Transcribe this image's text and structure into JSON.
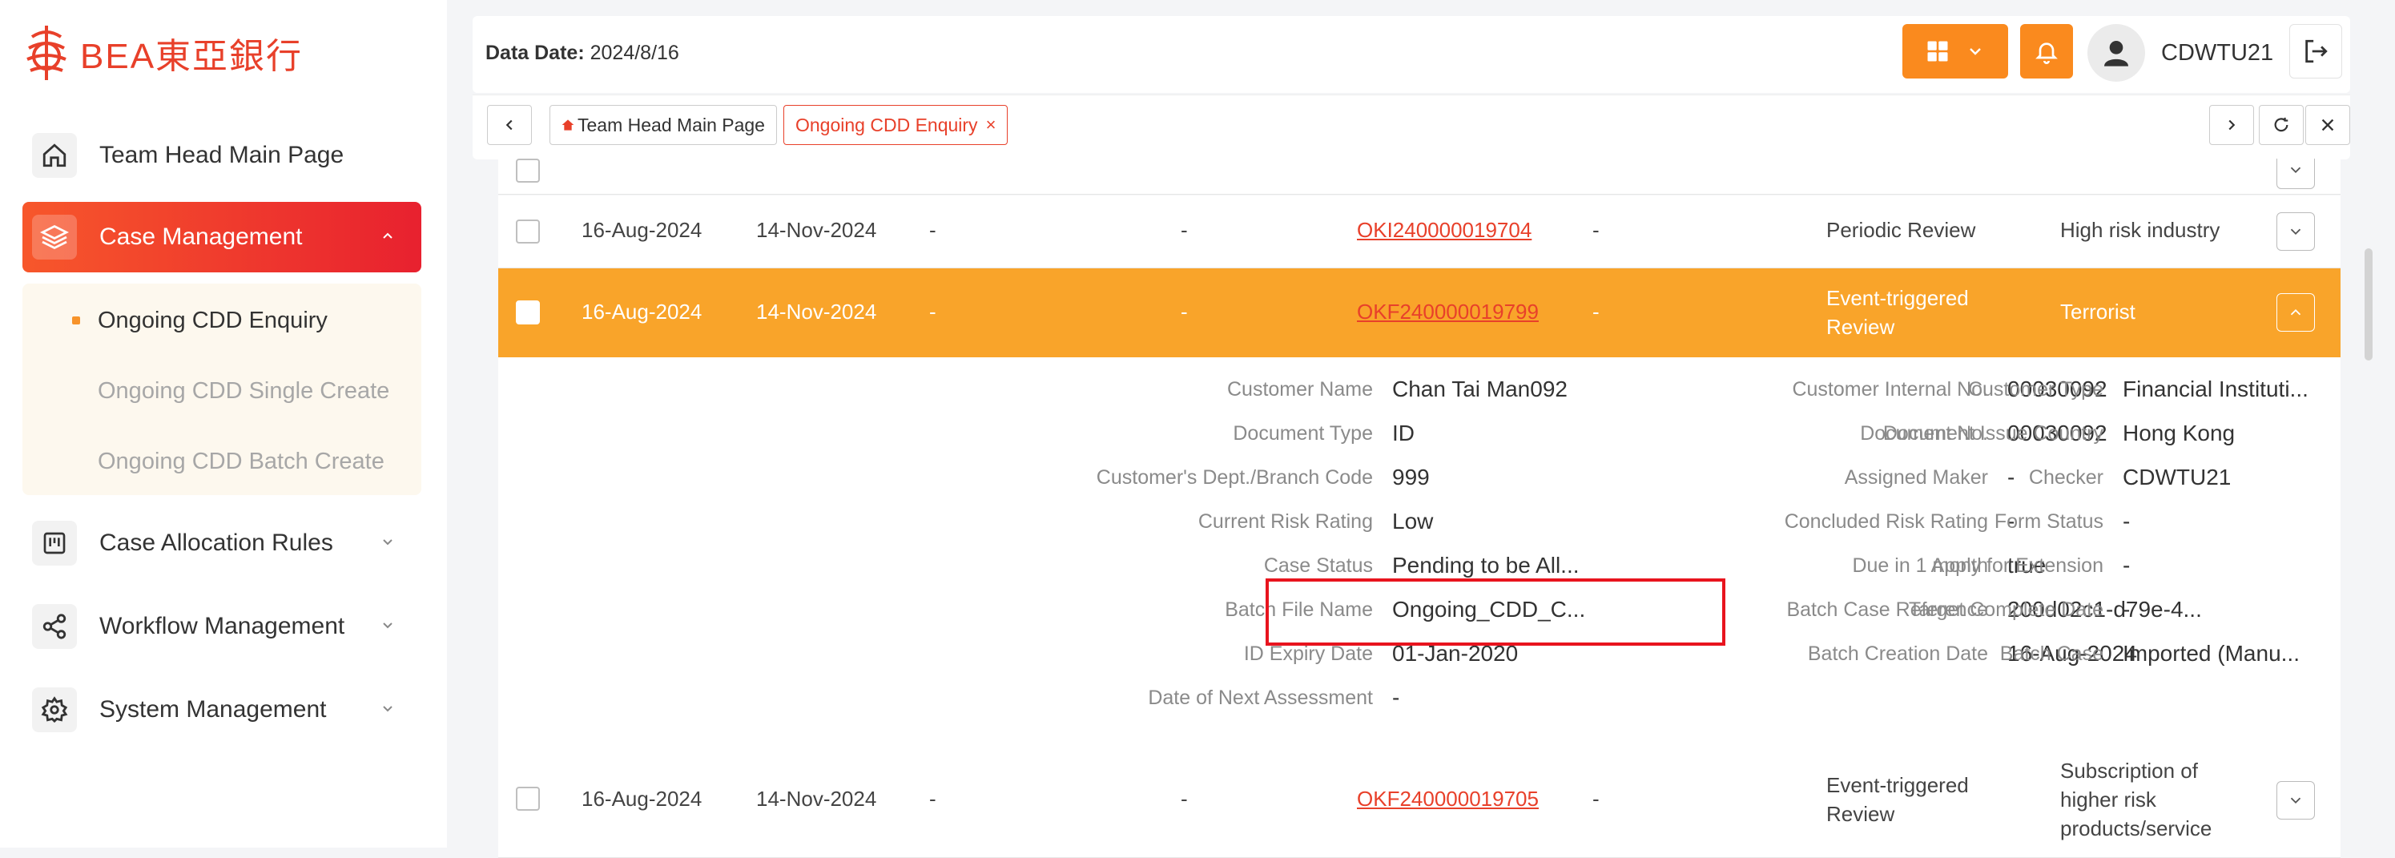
{
  "brand": {
    "name": "BEA東亞銀行",
    "color": "#e8402a"
  },
  "sidebar": {
    "items": [
      {
        "label": "Team Head Main Page",
        "icon": "home-icon"
      },
      {
        "label": "Case Management",
        "icon": "layers-icon"
      },
      {
        "label": "Case Allocation Rules",
        "icon": "rules-icon"
      },
      {
        "label": "Workflow Management",
        "icon": "share-icon"
      },
      {
        "label": "System Management",
        "icon": "gear-icon"
      }
    ],
    "submenu": [
      {
        "label": "Ongoing CDD Enquiry"
      },
      {
        "label": "Ongoing CDD Single Create"
      },
      {
        "label": "Ongoing CDD Batch Create"
      }
    ]
  },
  "header": {
    "data_date_label": "Data Date:",
    "data_date_value": "2024/8/16",
    "username": "CDWTU21",
    "accent": "#fa8a1e"
  },
  "tabs": [
    {
      "label": "Team Head Main Page"
    },
    {
      "label": "Ongoing CDD Enquiry",
      "close": "×"
    }
  ],
  "rows": [
    {
      "date1": "16-Aug-2024",
      "date2": "14-Nov-2024",
      "c3": "-",
      "c4": "-",
      "case_no": "OKI240000019704",
      "c6": "-",
      "type": "Periodic Review",
      "reason": "High risk industry"
    },
    {
      "date1": "16-Aug-2024",
      "date2": "14-Nov-2024",
      "c3": "-",
      "c4": "-",
      "case_no": "OKF240000019799",
      "c6": "-",
      "type": "Event-triggered Review",
      "reason": "Terrorist"
    },
    {
      "date1": "16-Aug-2024",
      "date2": "14-Nov-2024",
      "c3": "-",
      "c4": "-",
      "case_no": "OKF240000019705",
      "c6": "-",
      "type": "Event-triggered Review",
      "reason": "Subscription of higher risk products/service"
    }
  ],
  "details": [
    [
      {
        "label": "Customer Name",
        "value": "Chan Tai Man092"
      },
      {
        "label": "Document Type",
        "value": "ID"
      },
      {
        "label": "Customer's Dept./Branch Code",
        "value": "999"
      },
      {
        "label": "Current Risk Rating",
        "value": "Low"
      },
      {
        "label": "Case Status",
        "value": "Pending to be All..."
      },
      {
        "label": "Batch File Name",
        "value": "Ongoing_CDD_C..."
      },
      {
        "label": "ID Expiry Date",
        "value": "01-Jan-2020"
      },
      {
        "label": "Date of Next Assessment",
        "value": "-"
      }
    ],
    [
      {
        "label": "Customer Internal No.",
        "value": "00030092"
      },
      {
        "label": "Document No.",
        "value": "00030092"
      },
      {
        "label": "Assigned Maker",
        "value": "-"
      },
      {
        "label": "Concluded Risk Rating",
        "value": "-"
      },
      {
        "label": "Due in 1 month",
        "value": "true"
      },
      {
        "label": "Batch Case Reference",
        "value": "200d02c1-d79e-4..."
      },
      {
        "label": "Batch Creation Date",
        "value": "16-Aug-2024"
      }
    ],
    [
      {
        "label": "Customer Type",
        "value": "Financial Instituti..."
      },
      {
        "label": "Document Issue Country",
        "value": "Hong Kong"
      },
      {
        "label": "Checker",
        "value": "CDWTU21"
      },
      {
        "label": "Form Status",
        "value": "-"
      },
      {
        "label": "Apply for Extension",
        "value": "-"
      },
      {
        "label": "Target Complete Date",
        "value": "-"
      },
      {
        "label": "Batch Case",
        "value": "Imported (Manu..."
      }
    ]
  ],
  "colors": {
    "highlight_row": "#f9a42a",
    "link": "#e8402a",
    "active_nav": "#e8212f",
    "callout_box": "#e8141e"
  }
}
